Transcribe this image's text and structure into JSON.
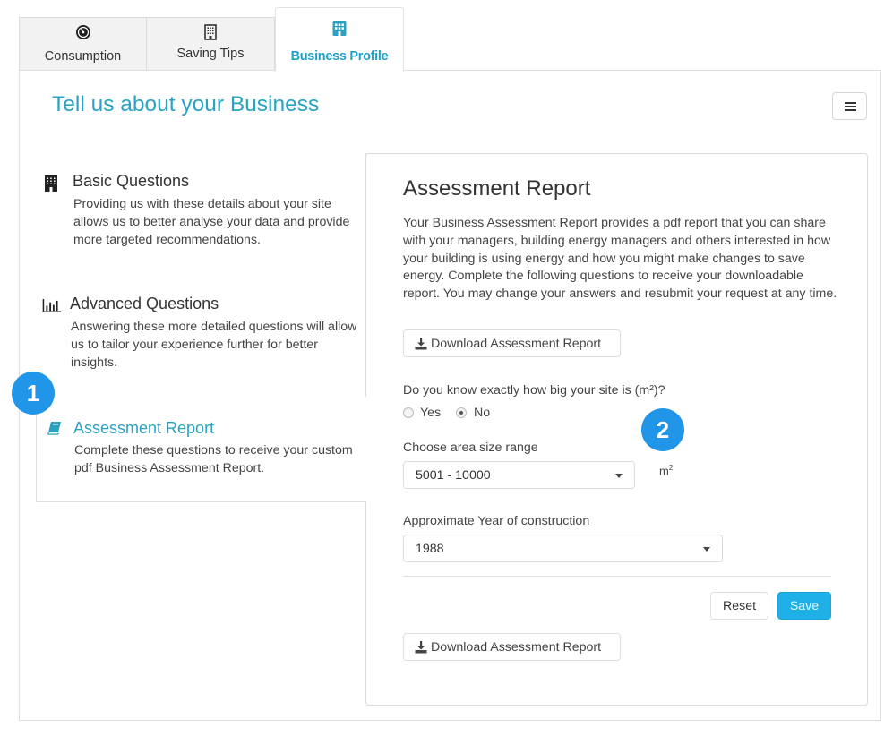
{
  "tabs": [
    {
      "label": "Consumption",
      "icon": "gauge-icon",
      "active": false
    },
    {
      "label": "Saving Tips",
      "icon": "building-icon",
      "active": false
    },
    {
      "label": "Business Profile",
      "icon": "grid-building-icon",
      "active": true
    }
  ],
  "header": {
    "title": "Tell us about your Business",
    "menu_icon": "hamburger-icon"
  },
  "nav": {
    "items": [
      {
        "title": "Basic Questions",
        "icon": "building-icon",
        "description": "Providing us with these details about your site allows us to better analyse your data and provide more targeted recommendations.",
        "active": false
      },
      {
        "title": "Advanced Questions",
        "icon": "bar-chart-icon",
        "description": "Answering these more detailed questions will allow us to tailor your experience further for better insights.",
        "active": false
      },
      {
        "title": "Assessment Report",
        "icon": "book-icon",
        "description": "Complete these questions to receive your custom pdf Business Assessment Report.",
        "active": true
      }
    ]
  },
  "panel": {
    "title": "Assessment Report",
    "intro": "Your Business Assessment Report provides a pdf report that you can share with your managers, building energy managers and others interested in how your building is using energy and how you might make changes to save energy. Complete the following questions to receive your downloadable report. You may change your answers and resubmit your request at any time.",
    "download_label": "Download Assessment Report",
    "size_question": "Do you know exactly how big your site is (m²)?",
    "size_options": [
      {
        "label": "Yes",
        "checked": false
      },
      {
        "label": "No",
        "checked": true
      }
    ],
    "area_label": "Choose area size range",
    "area_value": "5001 - 10000",
    "area_unit": "m",
    "area_unit_sup": "2",
    "year_label": "Approximate Year of construction",
    "year_value": "1988",
    "reset_label": "Reset",
    "save_label": "Save"
  },
  "badges": [
    "1",
    "2"
  ],
  "colors": {
    "accent": "#2aa3c2",
    "primary_button": "#1eb0e6",
    "badge": "#2196e8"
  }
}
